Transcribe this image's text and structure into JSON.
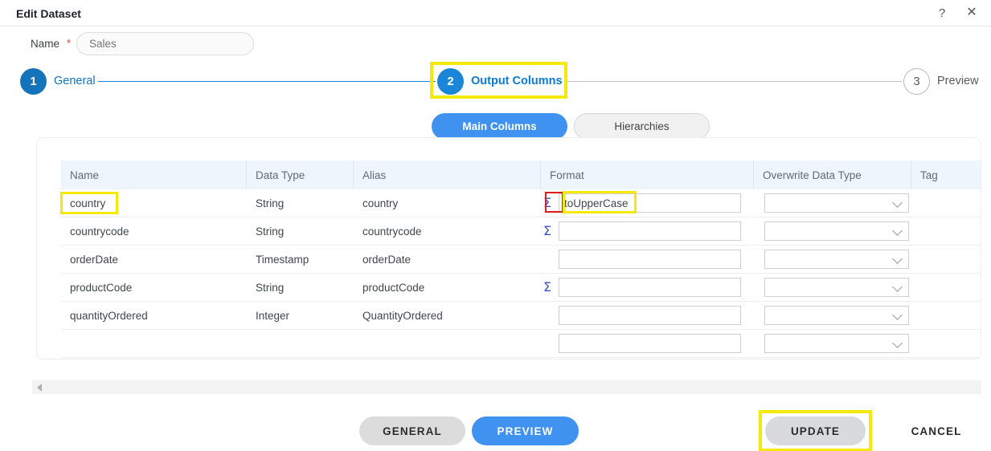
{
  "window": {
    "title": "Edit Dataset",
    "help_icon": "question-mark-icon",
    "close_icon": "close-icon"
  },
  "name_field": {
    "label": "Name",
    "required_marker": "*",
    "value": "",
    "placeholder": "Sales"
  },
  "stepper": {
    "steps": [
      {
        "number": "1",
        "label": "General",
        "state": "done"
      },
      {
        "number": "2",
        "label": "Output Columns",
        "state": "active",
        "highlighted": true
      },
      {
        "number": "3",
        "label": "Preview",
        "state": "idle"
      }
    ]
  },
  "tabs": [
    {
      "label": "Main Columns",
      "active": true
    },
    {
      "label": "Hierarchies",
      "active": false
    }
  ],
  "table": {
    "columns": [
      "Name",
      "Data Type",
      "Alias",
      "Format",
      "Overwrite Data Type",
      "Tag"
    ],
    "rows": [
      {
        "name": "country",
        "data_type": "String",
        "alias": "country",
        "has_sigma": true,
        "format": "toUpperCase",
        "overwrite_data_type": "",
        "tag": "",
        "name_highlighted": true,
        "sigma_highlighted": true,
        "format_highlighted": true
      },
      {
        "name": "countrycode",
        "data_type": "String",
        "alias": "countrycode",
        "has_sigma": true,
        "format": "",
        "overwrite_data_type": "",
        "tag": ""
      },
      {
        "name": "orderDate",
        "data_type": "Timestamp",
        "alias": "orderDate",
        "has_sigma": false,
        "format": "",
        "overwrite_data_type": "",
        "tag": ""
      },
      {
        "name": "productCode",
        "data_type": "String",
        "alias": "productCode",
        "has_sigma": true,
        "format": "",
        "overwrite_data_type": "",
        "tag": ""
      },
      {
        "name": "quantityOrdered",
        "data_type": "Integer",
        "alias": "QuantityOrdered",
        "has_sigma": false,
        "format": "",
        "overwrite_data_type": "",
        "tag": ""
      },
      {
        "name": "",
        "data_type": "",
        "alias": "",
        "has_sigma": false,
        "format": "",
        "overwrite_data_type": "",
        "tag": ""
      }
    ],
    "sigma_icon": "sigma-icon",
    "dropdown_icon": "chevron-down-icon"
  },
  "scrollbar": {
    "left_arrow_icon": "arrow-left-icon"
  },
  "footer": {
    "general_label": "GENERAL",
    "preview_label": "PREVIEW",
    "update_label": "UPDATE",
    "cancel_label": "CANCEL",
    "update_highlighted": true
  },
  "colors": {
    "accent_blue": "#3f92f0",
    "step_blue": "#1573b9",
    "highlight_yellow": "#f5e80b",
    "highlight_red": "#d81e1e",
    "header_blue": "#eef5fc",
    "sigma_purple": "#3f4fc0"
  }
}
